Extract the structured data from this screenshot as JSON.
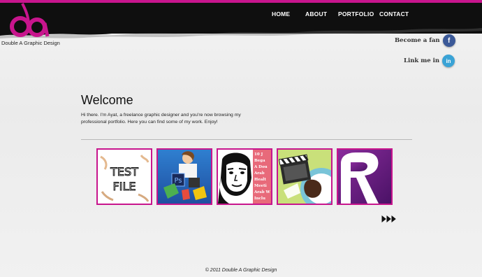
{
  "brand": {
    "logo_text": "da",
    "name": "Double A Graphic Design",
    "accent_color": "#c8158d"
  },
  "nav": {
    "items": [
      {
        "label": "HOME"
      },
      {
        "label": "ABOUT"
      },
      {
        "label": "PORTFOLIO"
      },
      {
        "label": "CONTACT"
      }
    ]
  },
  "social": {
    "facebook": {
      "label": "Become a fan",
      "icon": "facebook-icon",
      "glyph": "f",
      "color": "#3b5998"
    },
    "linkedin": {
      "label": "Link me in",
      "icon": "linkedin-icon",
      "glyph": "in",
      "color": "#3aa3d6"
    }
  },
  "welcome": {
    "title": "Welcome",
    "text": "Hi there. I'm Ayat, a freelance graphic designer and you're now browsing my professional portfolio. Here you can find some of my work. Enjoy!"
  },
  "gallery": {
    "thumbnails": [
      {
        "name": "test-file",
        "text": "TEST FILE"
      },
      {
        "name": "photoshop-girl",
        "text": "Ps"
      },
      {
        "name": "portrait-poster",
        "lines": [
          "10 J",
          "Bega",
          "A Dou",
          "Arab",
          "Healt",
          "Meeti",
          "Arab W",
          "Inclu"
        ]
      },
      {
        "name": "film-clapper",
        "text": ""
      },
      {
        "name": "purple-r-logo",
        "text": "R"
      }
    ],
    "next_icon": "triple-chevron-right-icon"
  },
  "footer": {
    "text": "© 2011 Double A Graphic Design"
  }
}
